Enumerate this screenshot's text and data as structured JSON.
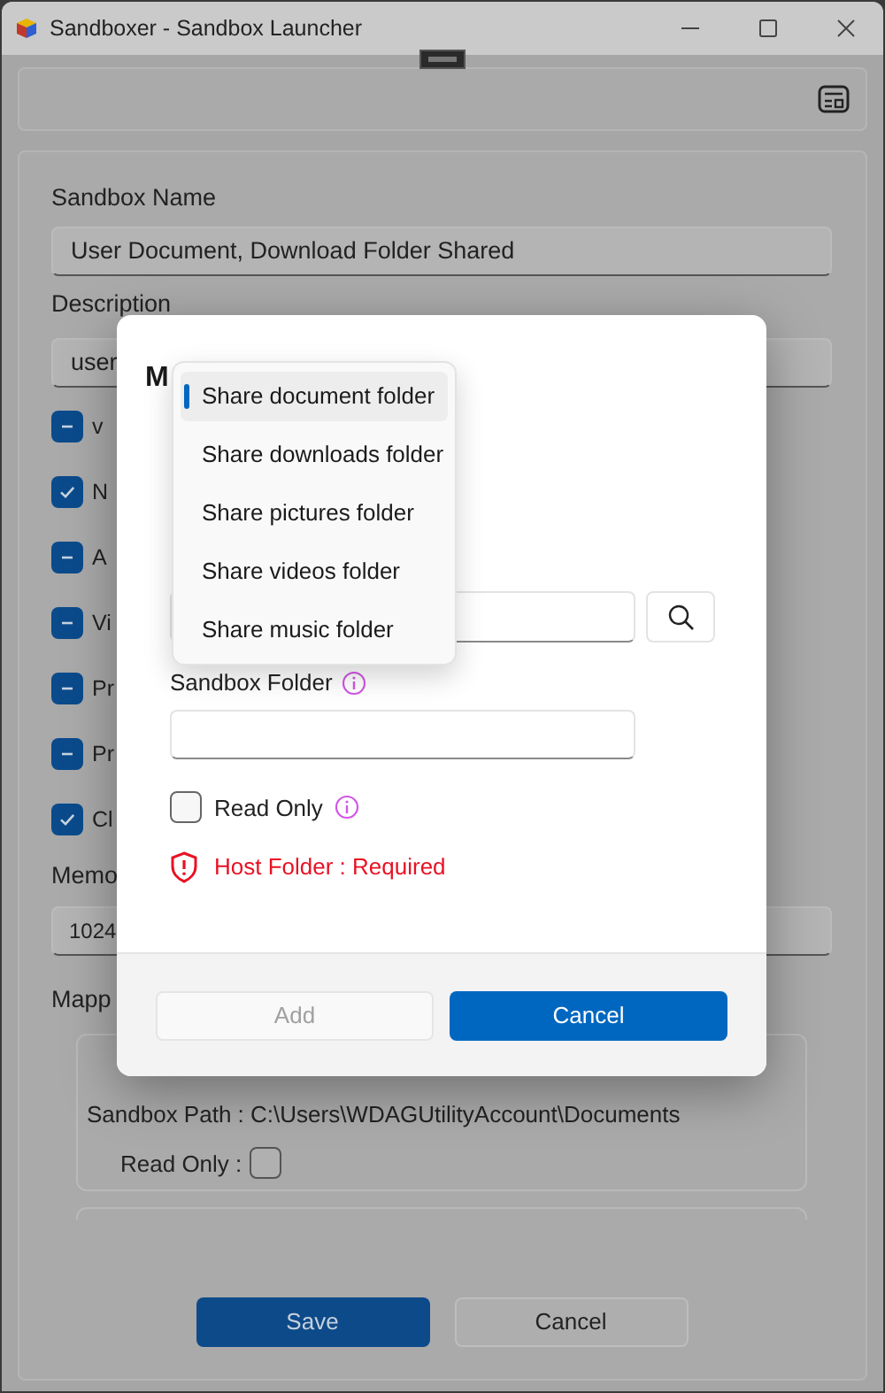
{
  "window": {
    "title": "Sandboxer - Sandbox Launcher"
  },
  "form": {
    "name_label": "Sandbox Name",
    "name_value": "User Document, Download Folder Shared",
    "description_label": "Description",
    "description_value": "user",
    "options": [
      {
        "label": "v",
        "kind": "mixed"
      },
      {
        "label": "N",
        "kind": "checked"
      },
      {
        "label": "A",
        "kind": "mixed"
      },
      {
        "label": "Vi",
        "kind": "mixed"
      },
      {
        "label": "Pr",
        "kind": "mixed"
      },
      {
        "label": "Pr",
        "kind": "mixed"
      },
      {
        "label": "Cl",
        "kind": "checked"
      }
    ],
    "memory_label": "Memo",
    "memory_value": "1024",
    "mapped_label": "Mapp",
    "mapped_folder": {
      "sandbox_path": "Sandbox Path : C:\\Users\\WDAGUtilityAccount\\Documents",
      "read_only_label": "Read Only :",
      "read_only": false
    },
    "buttons": [
      {
        "label": "Save",
        "primary": true
      },
      {
        "label": "Cancel",
        "primary": false
      }
    ]
  },
  "dialog": {
    "title": "M",
    "sandbox_folder_label": "Sandbox Folder",
    "read_only": {
      "label": "Read Only",
      "checked": false
    },
    "error": "Host Folder : Required",
    "buttons": [
      {
        "label": "Add",
        "primary": false,
        "disabled": true
      },
      {
        "label": "Cancel",
        "primary": true,
        "disabled": false
      }
    ]
  },
  "menu": {
    "items": [
      {
        "label": "Share document folder",
        "selected": true
      },
      {
        "label": "Share downloads folder",
        "selected": false
      },
      {
        "label": "Share pictures folder",
        "selected": false
      },
      {
        "label": "Share videos folder",
        "selected": false
      },
      {
        "label": "Share music folder",
        "selected": false
      }
    ]
  }
}
